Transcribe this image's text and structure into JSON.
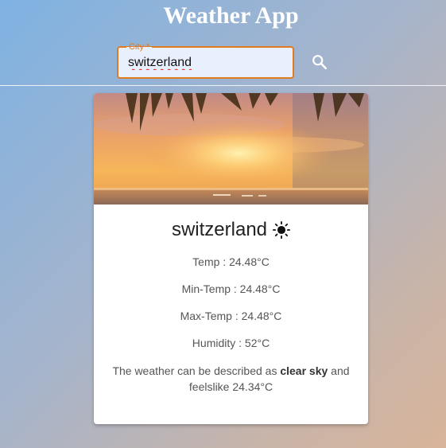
{
  "header": {
    "title": "Weather App"
  },
  "search": {
    "label": "City *",
    "value": "switzerland",
    "icon": "search-icon"
  },
  "card": {
    "image": "tropical-sunset-image",
    "city": "switzerland",
    "weather_icon": "sun-icon",
    "temp": "Temp : 24.48°C",
    "min_temp": "Min-Temp : 24.48°C",
    "max_temp": "Max-Temp : 24.48°C",
    "humidity": "Humidity : 52°C",
    "description_prefix": "The weather can be described as ",
    "description_condition": "clear sky",
    "description_suffix": " and feelslike 24.34°C"
  },
  "colors": {
    "accent": "#e07b22",
    "input_bg": "#e8f0fe"
  }
}
